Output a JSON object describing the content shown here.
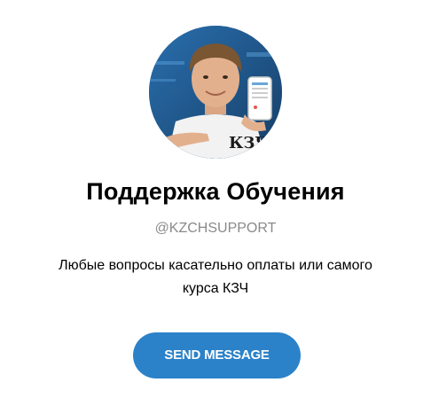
{
  "profile": {
    "title": "Поддержка Обучения",
    "handle": "@KZCHSUPPORT",
    "description": "Любые вопросы касательно оплаты или самого курса КЗЧ",
    "avatar_shirt_text": "КЗЧ"
  },
  "actions": {
    "send_label": "SEND MESSAGE"
  },
  "colors": {
    "accent": "#2b82c9",
    "handle": "#8a8a8a",
    "avatar_bg": "#1f5f96"
  },
  "icons": {
    "avatar": "profile-photo"
  }
}
